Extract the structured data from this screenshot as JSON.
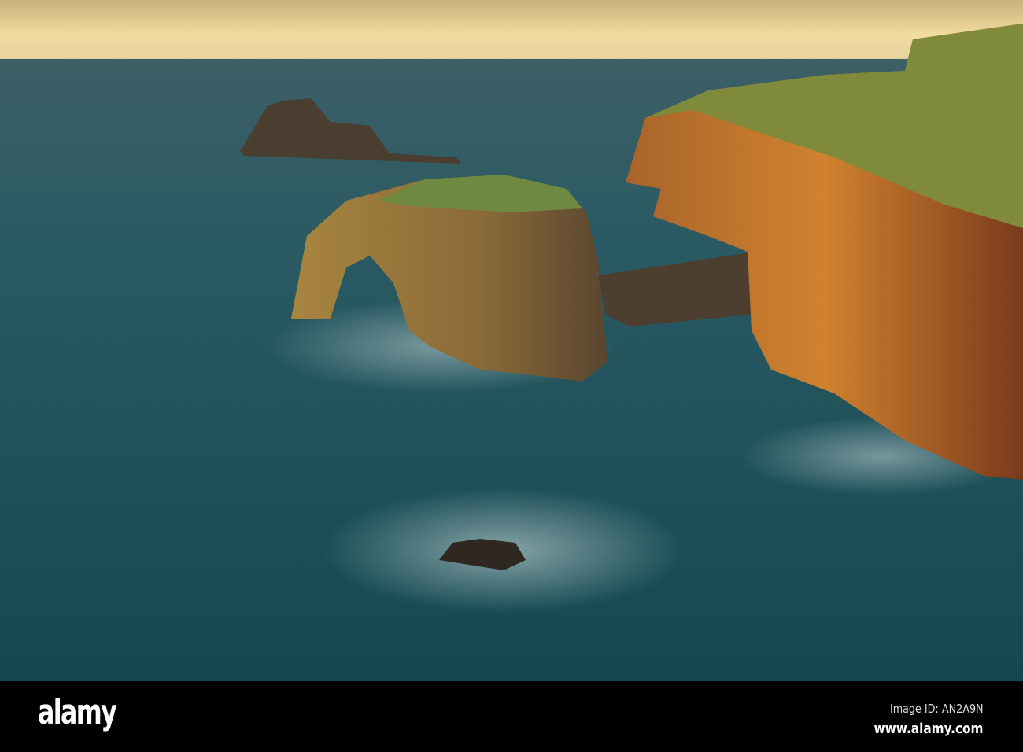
{
  "photo": {
    "subject": "sea-arch-coastline-sunset",
    "colors": {
      "sky": "#f0d9a0",
      "sea": "#1f5560",
      "cliff": "#c0702a",
      "grass": "#7f8a3a",
      "foam": "#d8e6e6"
    }
  },
  "watermark": {
    "logo": "alamy",
    "image_id": "Image ID: AN2A9N",
    "url": "www.alamy.com"
  }
}
